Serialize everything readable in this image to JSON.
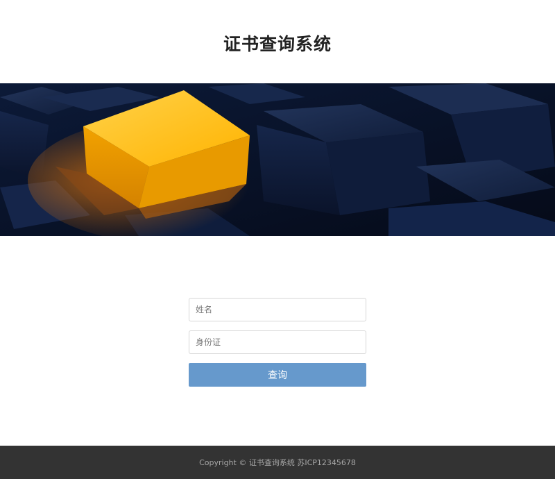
{
  "header": {
    "title": "证书查询系统"
  },
  "banner": {
    "slide_count": 1,
    "active_slide": 1
  },
  "form": {
    "name_placeholder": "姓名",
    "id_placeholder": "身份证",
    "submit_label": "查询"
  },
  "footer": {
    "copyright": "Copyright © 证书查询系统 苏ICP12345678"
  },
  "colors": {
    "button": "#6699cc",
    "footer_bg": "#333333",
    "carousel_dot": "#1e73e8",
    "banner_highlight": "#ffb800"
  }
}
